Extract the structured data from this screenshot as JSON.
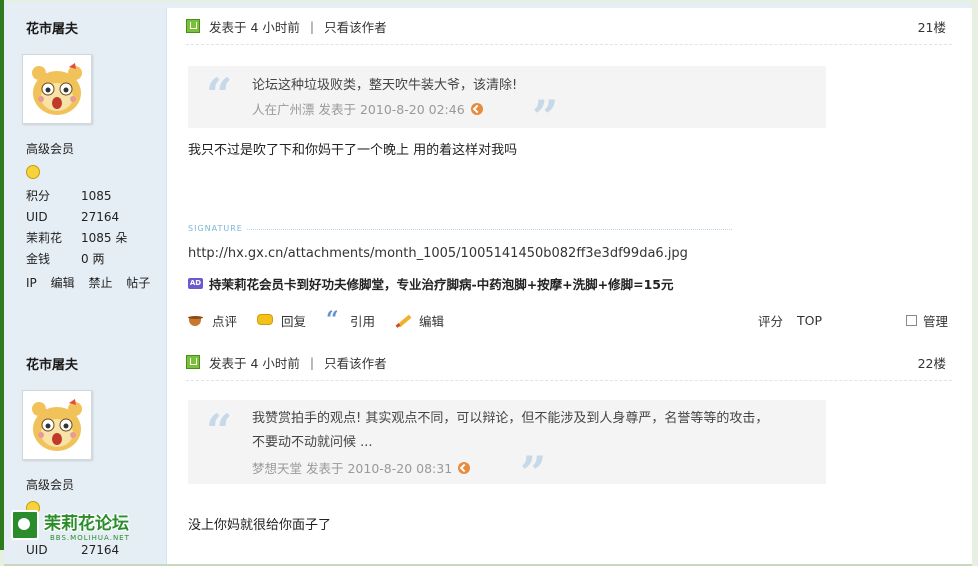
{
  "posts": [
    {
      "author": "花市屠夫",
      "rank": "高级会员",
      "stats": [
        {
          "k": "积分",
          "v": "1085"
        },
        {
          "k": "UID",
          "v": "27164"
        },
        {
          "k": "茉莉花",
          "v": "1085 朵"
        },
        {
          "k": "金钱",
          "v": "0 两"
        }
      ],
      "tools": [
        "IP",
        "编辑",
        "禁止",
        "帖子"
      ],
      "posted": "发表于 4 小时前",
      "only_author": "只看该作者",
      "floor": "21楼",
      "quote_text": "论坛这种垃圾败类，整天吹牛装大爷，该清除!",
      "quote_user": "人在广州漂",
      "quote_time": "发表于 2010-8-20 02:46",
      "body": "我只不过是吹了下和你妈干了一个晚上 用的着这样对我吗",
      "signature_label": "SIGNATURE",
      "signature_url": "http://hx.gx.cn/attachments/month_1005/1005141450b082ff3e3df99da6.jpg",
      "ad_badge": "AD",
      "ad_text": "持茉莉花会员卡到好功夫修脚堂，专业治疗脚病-中药泡脚+按摩+洗脚+修脚=15元",
      "actions": [
        "点评",
        "回复",
        "引用",
        "编辑"
      ],
      "rate": "评分",
      "top": "TOP",
      "manage": "管理"
    },
    {
      "author": "花市屠夫",
      "rank": "高级会员",
      "stats": [
        {
          "k": "UID",
          "v": "27164"
        }
      ],
      "posted": "发表于 4 小时前",
      "only_author": "只看该作者",
      "floor": "22楼",
      "quote_text_line1": "我赞赏拍手的观点! 其实观点不同，可以辩论，但不能涉及到人身尊严，名誉等等的攻击，",
      "quote_text_line2": "不要动不动就问候 ...",
      "quote_user": "梦想天堂",
      "quote_time": "发表于 2010-8-20 08:31",
      "body": "没上你妈就很给你面子了"
    }
  ],
  "watermark": {
    "name": "茉莉花论坛",
    "sub": "BBS.MOLIHUA.NET"
  },
  "colors": {
    "sidebar": "#e6eef5",
    "frame": "#2f7a1f",
    "quote_mark": "#c7d8e8"
  }
}
